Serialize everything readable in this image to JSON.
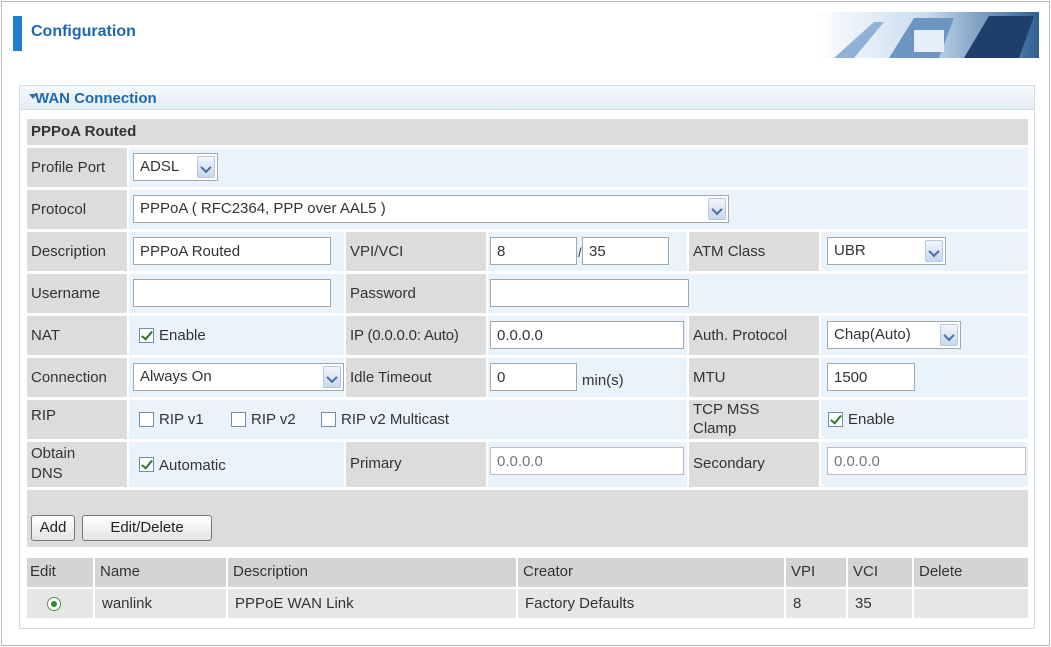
{
  "header": {
    "title": "Configuration"
  },
  "panel": {
    "title": "WAN Connection",
    "section": "PPPoA Routed"
  },
  "form": {
    "profile_port": {
      "label": "Profile Port",
      "value": "ADSL"
    },
    "protocol": {
      "label": "Protocol",
      "value": "PPPoA ( RFC2364, PPP over AAL5 )"
    },
    "description": {
      "label": "Description",
      "value": "PPPoA Routed"
    },
    "vpivci": {
      "label": "VPI/VCI",
      "vpi": "8",
      "separator": "/",
      "vci": "35"
    },
    "atm_class": {
      "label": "ATM Class",
      "value": "UBR"
    },
    "username": {
      "label": "Username",
      "value": ""
    },
    "password": {
      "label": "Password",
      "value": ""
    },
    "nat": {
      "label": "NAT",
      "option": "Enable",
      "checked": true
    },
    "ip": {
      "label": "IP (0.0.0.0: Auto)",
      "value": "0.0.0.0"
    },
    "auth_protocol": {
      "label": "Auth. Protocol",
      "value": "Chap(Auto)"
    },
    "connection": {
      "label": "Connection",
      "value": "Always On"
    },
    "idle_timeout": {
      "label": "Idle Timeout",
      "value": "0",
      "unit": "min(s)"
    },
    "mtu": {
      "label": "MTU",
      "value": "1500"
    },
    "rip": {
      "label": "RIP",
      "v1": "RIP v1",
      "v2": "RIP v2",
      "v2m": "RIP v2 Multicast"
    },
    "tcp_mss": {
      "label_line1": "TCP MSS",
      "label_line2": "Clamp",
      "option": "Enable",
      "checked": true
    },
    "obtain_dns": {
      "label_line1": "Obtain",
      "label_line2": "DNS",
      "option": "Automatic",
      "checked": true
    },
    "primary": {
      "label": "Primary",
      "placeholder": "0.0.0.0"
    },
    "secondary": {
      "label": "Secondary",
      "placeholder": "0.0.0.0"
    }
  },
  "buttons": {
    "add": "Add",
    "edit_delete": "Edit/Delete"
  },
  "table": {
    "headers": {
      "edit": "Edit",
      "name": "Name",
      "description": "Description",
      "creator": "Creator",
      "vpi": "VPI",
      "vci": "VCI",
      "delete": "Delete"
    },
    "rows": [
      {
        "name": "wanlink",
        "description": "PPPoE WAN Link",
        "creator": "Factory Defaults",
        "vpi": "8",
        "vci": "35",
        "delete": ""
      }
    ]
  },
  "colors": {
    "accent": "#1f7ed1",
    "label_cell": "#dcdcdc",
    "value_cell": "#eaf3fb"
  }
}
